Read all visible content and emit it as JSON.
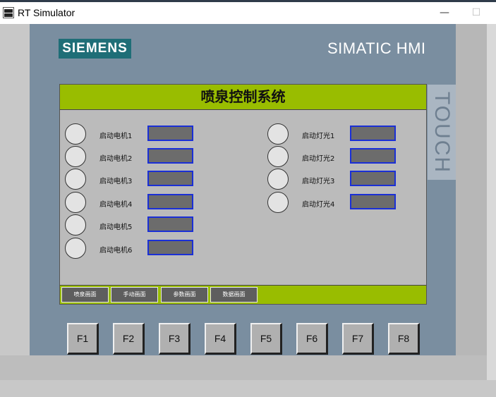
{
  "window": {
    "title": "RT Simulator",
    "minimize_glyph": "—",
    "maximize_glyph": "☐"
  },
  "brand": {
    "logo": "SIEMENS",
    "model": "SIMATIC HMI",
    "side_label": "TOUCH",
    "logo_color": "#1f6e77"
  },
  "screen": {
    "title": "喷泉控制系统",
    "motors": [
      {
        "label": "启动电机1",
        "value": ""
      },
      {
        "label": "启动电机2",
        "value": ""
      },
      {
        "label": "启动电机3",
        "value": ""
      },
      {
        "label": "启动电机4",
        "value": ""
      },
      {
        "label": "启动电机5",
        "value": ""
      },
      {
        "label": "启动电机6",
        "value": ""
      }
    ],
    "lights": [
      {
        "label": "启动灯光1",
        "value": ""
      },
      {
        "label": "启动灯光2",
        "value": ""
      },
      {
        "label": "启动灯光3",
        "value": ""
      },
      {
        "label": "启动灯光4",
        "value": ""
      }
    ],
    "nav": [
      "喷泉画面",
      "手动画面",
      "参数画面",
      "数据画面"
    ],
    "accent_color": "#99bd00",
    "field_border_color": "#1a2fd6"
  },
  "function_keys": [
    "F1",
    "F2",
    "F3",
    "F4",
    "F5",
    "F6",
    "F7",
    "F8"
  ]
}
